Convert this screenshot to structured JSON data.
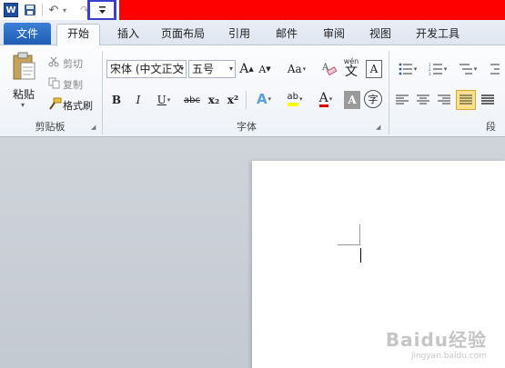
{
  "quick_access": {
    "app_icon_letter": "W",
    "customize_glyph": "▾"
  },
  "tabs": [
    "文件",
    "开始",
    "插入",
    "页面布局",
    "引用",
    "邮件",
    "审阅",
    "视图",
    "开发工具"
  ],
  "clipboard": {
    "paste_label": "粘贴",
    "cut_label": "剪切",
    "copy_label": "复制",
    "format_painter_label": "格式刷",
    "group_label": "剪贴板"
  },
  "font": {
    "font_name": "宋体 (中文正文",
    "font_size": "五号",
    "bold": "B",
    "italic": "I",
    "underline": "U",
    "strike": "abc",
    "subscript": "x₂",
    "superscript": "x²",
    "grow": "A",
    "shrink": "A",
    "change_case": "Aa",
    "phonetic_top": "wén",
    "phonetic_char": "文",
    "border_char": "A",
    "text_effect": "A",
    "highlight": "ab",
    "font_color": "A",
    "shading": "A",
    "enclose": "字",
    "group_label": "字体"
  },
  "paragraph": {
    "group_label": "段"
  },
  "watermark": {
    "brand": "Baidu经验",
    "url": "jingyan.baidu.com"
  },
  "colors": {
    "title_bar": "#ff0000",
    "file_tab": "#2a6bc4",
    "highlight_box": "#3a3fcf",
    "highlight_yellow": "#ffff00",
    "font_red": "#e00000"
  }
}
